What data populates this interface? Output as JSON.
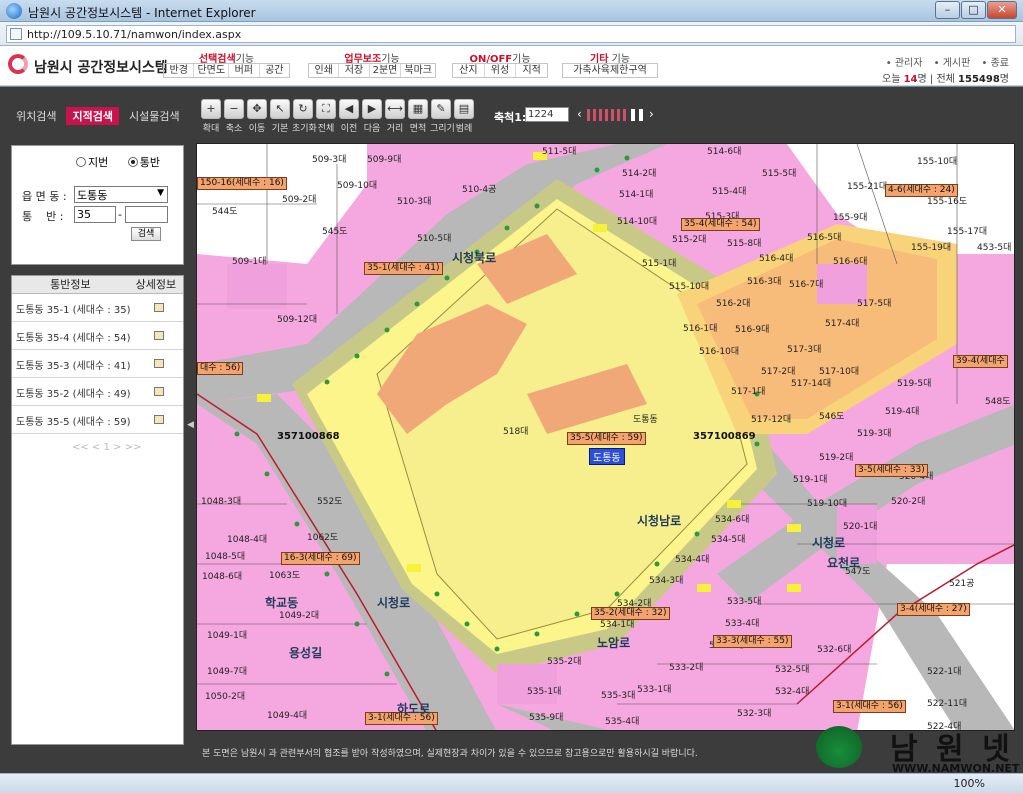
{
  "window": {
    "title": "남원시 공간정보시스템 - Internet Explorer",
    "url": "http://109.5.10.71/namwon/index.aspx",
    "minimize": "–",
    "maximize": "□",
    "close": "✕"
  },
  "header": {
    "site_title": "남원시 공간정보시스템",
    "menu_groups": [
      {
        "label_strong": "선택검색",
        "label_rest": "기능",
        "items": [
          "반경",
          "단면도",
          "버퍼",
          "공간"
        ]
      },
      {
        "label_strong": "업무보조",
        "label_rest": "기능",
        "items": [
          "인쇄",
          "저장",
          "2분면",
          "북마크"
        ]
      },
      {
        "label_strong": "ON/OFF",
        "label_rest": "기능",
        "items": [
          "산지",
          "위성",
          "지적"
        ]
      },
      {
        "label_strong": "기타",
        "label_rest": " 기능",
        "items": [
          "가축사육제한구역"
        ]
      }
    ],
    "top_links": [
      "• 관리자",
      "• 게시판",
      "• 종료"
    ],
    "visitors": {
      "today_label": "오늘",
      "today": "14",
      "unit1": "명",
      "total_label": "전체",
      "total": "155498",
      "unit2": "명"
    }
  },
  "left_tabs": [
    "위치검색",
    "지적검색",
    "시설물검색"
  ],
  "search": {
    "radio_jibun": "지번",
    "radio_tongban": "통반",
    "dong_label": "읍 면 동 :",
    "dong_value": "도통동",
    "ban_label": "통    반 :",
    "ban_value": "35",
    "ban_dash": "-",
    "button": "검색"
  },
  "results": {
    "col_info": "통반정보",
    "col_detail": "상세정보",
    "rows": [
      "도통동 35-1 (세대수 : 35)",
      "도통동 35-4 (세대수 : 54)",
      "도통동 35-3 (세대수 : 41)",
      "도통동 35-2 (세대수 : 49)",
      "도통동 35-5 (세대수 : 59)"
    ],
    "pager": "<< < 1 > >>"
  },
  "toolbar": {
    "tools": [
      {
        "label": "확대",
        "glyph": "+"
      },
      {
        "label": "축소",
        "glyph": "−"
      },
      {
        "label": "이동",
        "glyph": "✥"
      },
      {
        "label": "기본",
        "glyph": "↖"
      },
      {
        "label": "초기화",
        "glyph": "↻"
      },
      {
        "label": "전체",
        "glyph": "⛶"
      },
      {
        "label": "이전",
        "glyph": "◀"
      },
      {
        "label": "다음",
        "glyph": "▶"
      },
      {
        "label": "거리",
        "glyph": "⟷"
      },
      {
        "label": "면적",
        "glyph": "▦"
      },
      {
        "label": "그리기",
        "glyph": "✎"
      },
      {
        "label": "범례",
        "glyph": "▤"
      }
    ],
    "scale_label": "축척1:",
    "scale_value": "1224",
    "zoom_left": "‹",
    "zoom_right": "›"
  },
  "map": {
    "parcels": [
      {
        "t": "509-3대"
      },
      {
        "t": "509-9대"
      },
      {
        "t": "509-10대"
      },
      {
        "t": "509-2대"
      },
      {
        "t": "510-3대"
      },
      {
        "t": "510-4공"
      },
      {
        "t": "510-5대"
      },
      {
        "t": "509-1대"
      },
      {
        "t": "509-12대"
      },
      {
        "t": "544도"
      },
      {
        "t": "545도"
      },
      {
        "t": "511-5대"
      },
      {
        "t": "514-6대"
      },
      {
        "t": "514-2대"
      },
      {
        "t": "515-4대"
      },
      {
        "t": "515-5대"
      },
      {
        "t": "514-1대"
      },
      {
        "t": "514-10대"
      },
      {
        "t": "515-3대"
      },
      {
        "t": "515-2대"
      },
      {
        "t": "515-8대"
      },
      {
        "t": "515-1대"
      },
      {
        "t": "515-10대"
      },
      {
        "t": "516-4대"
      },
      {
        "t": "516-5대"
      },
      {
        "t": "516-6대"
      },
      {
        "t": "516-3대"
      },
      {
        "t": "516-7대"
      },
      {
        "t": "516-2대"
      },
      {
        "t": "516-9대"
      },
      {
        "t": "516-1대"
      },
      {
        "t": "516-10대"
      },
      {
        "t": "517-4대"
      },
      {
        "t": "517-5대"
      },
      {
        "t": "517-3대"
      },
      {
        "t": "517-2대"
      },
      {
        "t": "517-10대"
      },
      {
        "t": "517-14대"
      },
      {
        "t": "517-1대"
      },
      {
        "t": "517-12대"
      },
      {
        "t": "546도"
      },
      {
        "t": "518대"
      },
      {
        "t": "519-5대"
      },
      {
        "t": "519-4대"
      },
      {
        "t": "519-3대"
      },
      {
        "t": "519-2대"
      },
      {
        "t": "519-1대"
      },
      {
        "t": "519-10대"
      },
      {
        "t": "520-4대"
      },
      {
        "t": "520-2대"
      },
      {
        "t": "520-1대"
      },
      {
        "t": "521공"
      },
      {
        "t": "534-6대"
      },
      {
        "t": "534-5대"
      },
      {
        "t": "534-4대"
      },
      {
        "t": "534-3대"
      },
      {
        "t": "534-2대"
      },
      {
        "t": "534-1대"
      },
      {
        "t": "533-5대"
      },
      {
        "t": "533-4대"
      },
      {
        "t": "533-3대"
      },
      {
        "t": "533-2대"
      },
      {
        "t": "533-1대"
      },
      {
        "t": "532-5대"
      },
      {
        "t": "532-4대"
      },
      {
        "t": "532-3대"
      },
      {
        "t": "532-6대"
      },
      {
        "t": "535-2대"
      },
      {
        "t": "535-1대"
      },
      {
        "t": "535-3대"
      },
      {
        "t": "535-9대"
      },
      {
        "t": "535-4대"
      },
      {
        "t": "1048-3대"
      },
      {
        "t": "1048-4대"
      },
      {
        "t": "1048-5대"
      },
      {
        "t": "1048-6대"
      },
      {
        "t": "1062도"
      },
      {
        "t": "1063도"
      },
      {
        "t": "1049-1대"
      },
      {
        "t": "1049-2대"
      },
      {
        "t": "1049-7대"
      },
      {
        "t": "1050-2대"
      },
      {
        "t": "1049-4대"
      },
      {
        "t": "1050-3대"
      },
      {
        "t": "1049-5대"
      },
      {
        "t": "552도"
      },
      {
        "t": "522-1대"
      },
      {
        "t": "522-11대"
      },
      {
        "t": "522-4대"
      },
      {
        "t": "548도"
      },
      {
        "t": "547도"
      },
      {
        "t": "155-10대"
      },
      {
        "t": "155-21대"
      },
      {
        "t": "155-9대"
      },
      {
        "t": "155-16도"
      },
      {
        "t": "155-17대"
      },
      {
        "t": "155-19대"
      },
      {
        "t": "453-5대"
      }
    ],
    "households": [
      "150-16(세대수 : 16)",
      "35-4(세대수 : 54)",
      "35-1(세대수 : 41)",
      "4-6(세대수 : 24)",
      "대수 : 56)",
      "35-5(세대수 : 59)",
      "3-5(세대수 : 33)",
      "16-3(세대수 : 69)",
      "35-2(세대수 : 32)",
      "33-3(세대수 : 55)",
      "3-4(세대수 : 27)",
      "39-4(세대수",
      "3-1(세대수 : 56)",
      "3-1(세대수 : 56)"
    ],
    "codes": [
      "357100868",
      "357100869"
    ],
    "dong_label": "도통동",
    "dong_point": "도통동",
    "roads": [
      "시청북로",
      "시청남로",
      "시청로",
      "용성길",
      "하도로",
      "시청로",
      "요천로",
      "학교동",
      "노암로"
    ]
  },
  "footer": {
    "note": "본 도면은 남원시 과 관련부서의 협조를 받아 작성하였으며, 실제현장과 차이가 있을 수 있으므로 참고용으로만 활용하시길 바랍니다."
  },
  "watermark": {
    "text": "남 원 넷",
    "url": "WWW.NAMWON.NET"
  },
  "status": {
    "zoom": "100%"
  }
}
